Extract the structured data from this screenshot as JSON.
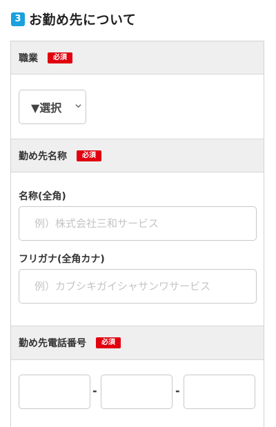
{
  "section": {
    "number": "3",
    "title": "お勤め先について"
  },
  "occupation": {
    "label": "職業",
    "required": "必須",
    "select_value": "▼選択"
  },
  "employer": {
    "label": "勤め先名称",
    "required": "必須",
    "name_label": "名称(全角)",
    "name_placeholder": "例）株式会社三和サービス",
    "kana_label": "フリガナ(全角カナ)",
    "kana_placeholder": "例）カブシキガイシャサンワサービス"
  },
  "phone": {
    "label": "勤め先電話番号",
    "required": "必須",
    "separator_1": "-",
    "separator_2": "-"
  },
  "colors": {
    "badge": "#1aa0dc",
    "required": "#e0000f",
    "row_header_bg": "#efefef",
    "border": "#d2d2d2"
  },
  "icons": [
    "chevron-down-icon"
  ]
}
